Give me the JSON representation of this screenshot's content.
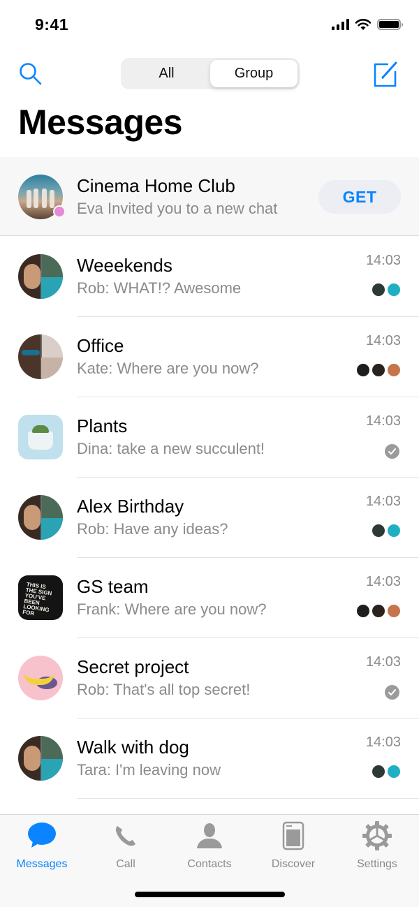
{
  "status_bar": {
    "time": "9:41"
  },
  "nav": {
    "segments": [
      {
        "label": "All",
        "active": false
      },
      {
        "label": "Group",
        "active": true
      }
    ]
  },
  "page_title": "Messages",
  "invite": {
    "title": "Cinema Home Club",
    "subtitle": "Eva Invited you to a new chat",
    "button_label": "GET"
  },
  "chats": [
    {
      "title": "Weeekends",
      "preview": "Rob: WHAT!? Awesome",
      "time": "14:03",
      "status": "avatars-2"
    },
    {
      "title": "Office",
      "preview": "Kate: Where are you now?",
      "time": "14:03",
      "status": "avatars-3"
    },
    {
      "title": "Plants",
      "preview": "Dina: take a new succulent!",
      "time": "14:03",
      "status": "read-check"
    },
    {
      "title": "Alex Birthday",
      "preview": "Rob: Have any ideas?",
      "time": "14:03",
      "status": "avatars-2"
    },
    {
      "title": "GS team",
      "preview": "Frank: Where are you now?",
      "time": "14:03",
      "status": "avatars-3"
    },
    {
      "title": "Secret project",
      "preview": "Rob: That's all top secret!",
      "time": "14:03",
      "status": "read-check"
    },
    {
      "title": "Walk with dog",
      "preview": "Tara: I'm leaving now",
      "time": "14:03",
      "status": "avatars-2"
    }
  ],
  "tabs": [
    {
      "label": "Messages",
      "icon": "chat-bubble-icon",
      "active": true
    },
    {
      "label": "Call",
      "icon": "phone-icon",
      "active": false
    },
    {
      "label": "Contacts",
      "icon": "person-icon",
      "active": false
    },
    {
      "label": "Discover",
      "icon": "discover-icon",
      "active": false
    },
    {
      "label": "Settings",
      "icon": "gear-icon",
      "active": false
    }
  ],
  "colors": {
    "accent": "#0a84ff",
    "secondary_text": "#8a8a8f"
  }
}
